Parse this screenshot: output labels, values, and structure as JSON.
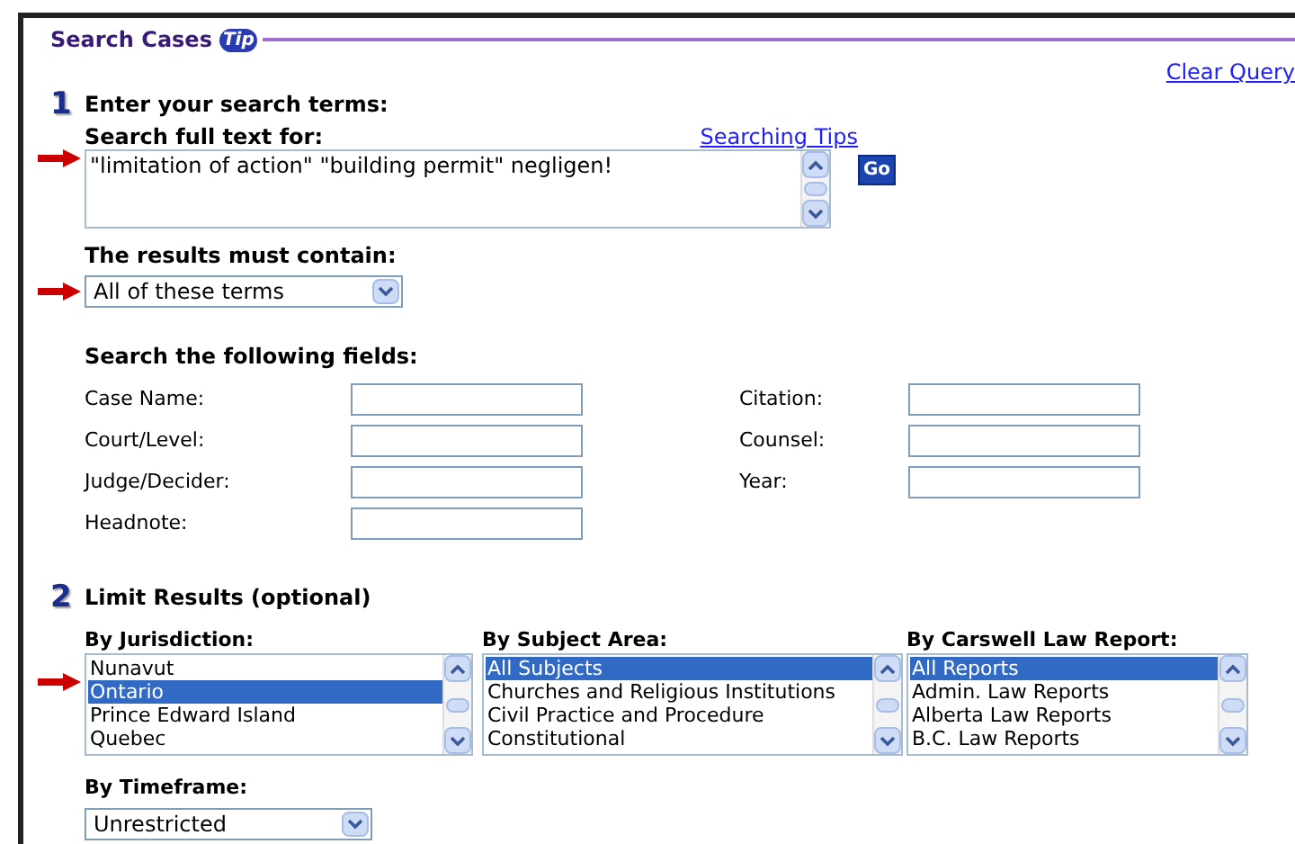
{
  "header": {
    "title": "Search Cases",
    "tip_badge": "Tip"
  },
  "clear_query": "Clear Query",
  "step1": {
    "number": "1",
    "heading": "Enter your search terms:",
    "full_text": {
      "label": "Search full text for:",
      "link": "Searching Tips",
      "value": "\"limitation of action\" \"building permit\" negligen!",
      "go": "Go",
      "arrow": true
    },
    "must_contain": {
      "label": "The results must contain:",
      "value": "All of these terms",
      "arrow": true
    },
    "fields_heading": "Search the following fields:",
    "fields": [
      {
        "label": "Case Name:"
      },
      {
        "label": "Citation:"
      },
      {
        "label": "Court/Level:"
      },
      {
        "label": "Counsel:"
      },
      {
        "label": "Judge/Decider:"
      },
      {
        "label": "Year:"
      },
      {
        "label": "Headnote:"
      }
    ]
  },
  "step2": {
    "number": "2",
    "heading": "Limit Results (optional)",
    "lists": [
      {
        "label": "By Jurisdiction:",
        "arrow": true,
        "items": [
          {
            "text": "Nunavut",
            "selected": false
          },
          {
            "text": "Ontario",
            "selected": true
          },
          {
            "text": "Prince Edward Island",
            "selected": false
          },
          {
            "text": "Quebec",
            "selected": false
          }
        ]
      },
      {
        "label": "By Subject Area:",
        "arrow": false,
        "items": [
          {
            "text": "All Subjects",
            "selected": true
          },
          {
            "text": "Churches and Religious Institutions",
            "selected": false
          },
          {
            "text": "Civil Practice and Procedure",
            "selected": false
          },
          {
            "text": "Constitutional",
            "selected": false
          }
        ]
      },
      {
        "label": "By Carswell Law Report:",
        "arrow": false,
        "items": [
          {
            "text": "All Reports",
            "selected": true
          },
          {
            "text": "Admin. Law Reports",
            "selected": false
          },
          {
            "text": "Alberta Law Reports",
            "selected": false
          },
          {
            "text": "B.C. Law Reports",
            "selected": false
          }
        ]
      }
    ],
    "timeframe": {
      "label": "By Timeframe:",
      "value": "Unrestricted"
    }
  }
}
